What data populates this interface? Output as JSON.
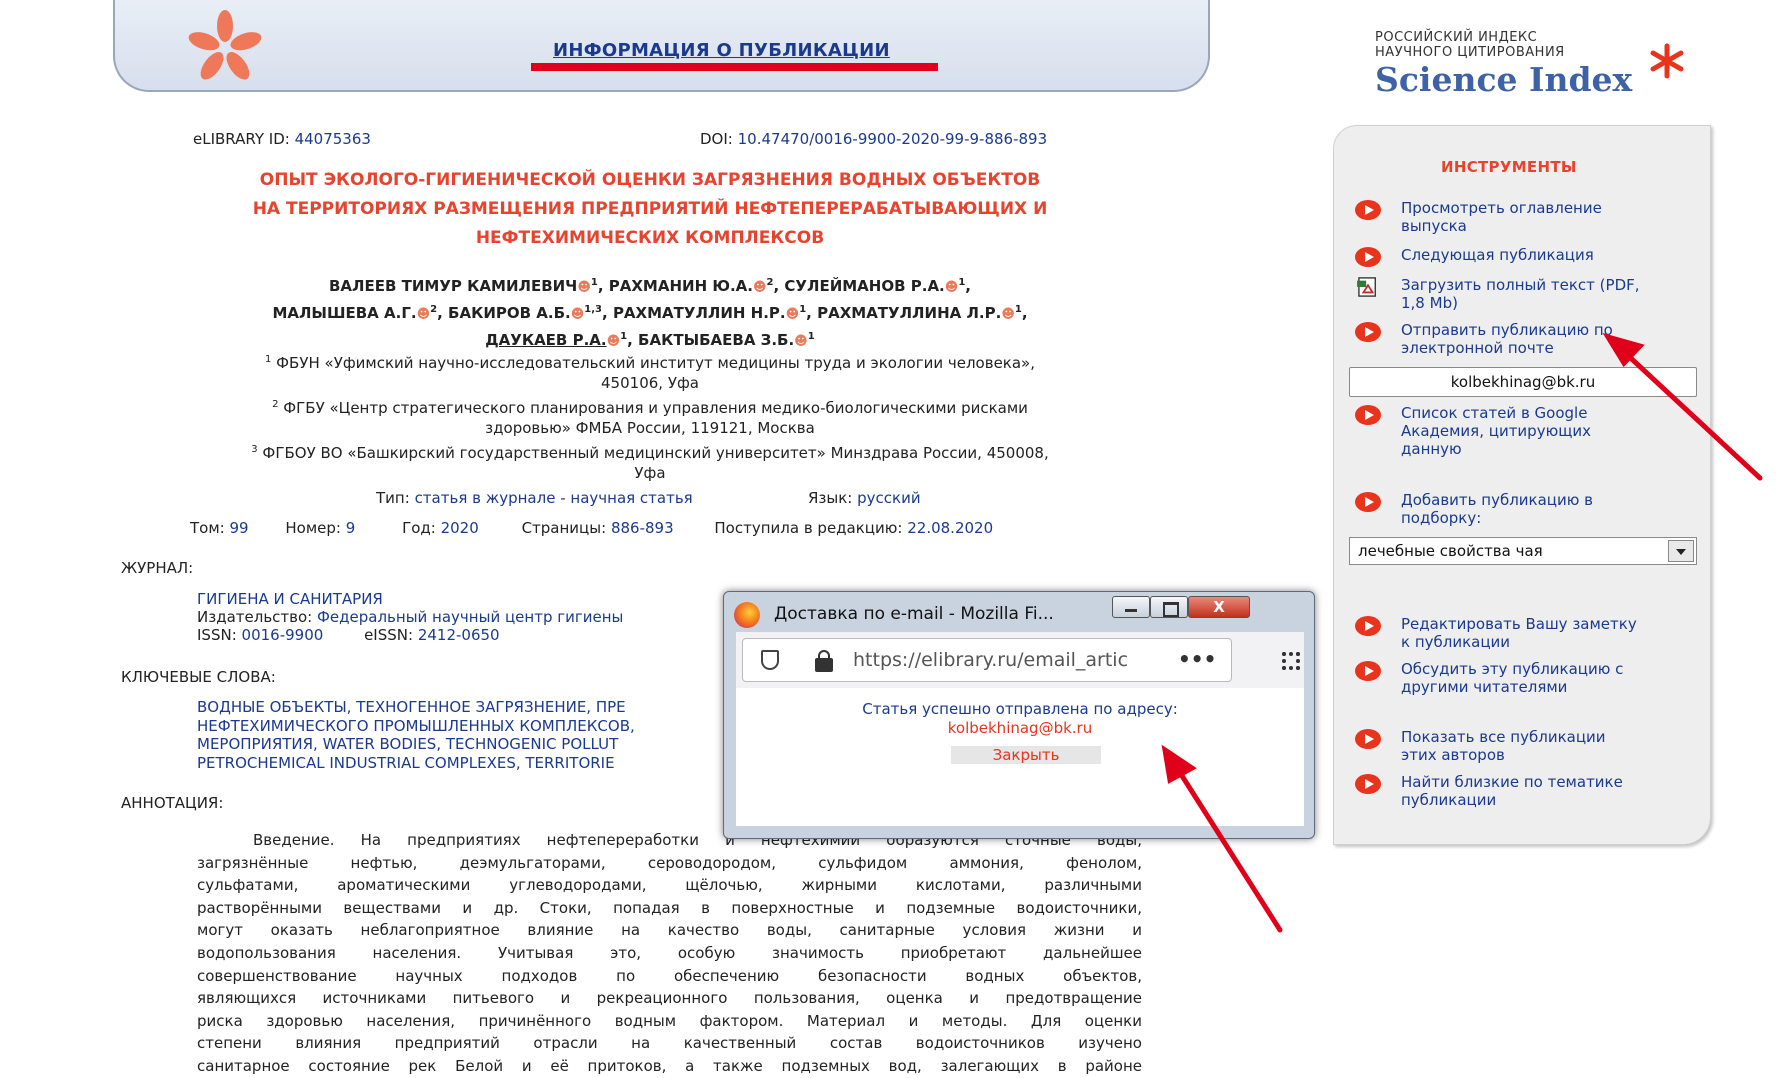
{
  "header": {
    "title": "ИНФОРМАЦИЯ О ПУБЛИКАЦИИ"
  },
  "logo": {
    "line1": "РОССИЙСКИЙ ИНДЕКС",
    "line2": "НАУЧНОГО ЦИТИРОВАНИЯ",
    "brand": "Science Index"
  },
  "publication": {
    "elibrary_label": "eLIBRARY ID:",
    "elibrary_id": "44075363",
    "doi_label": "DOI:",
    "doi": "10.47470/0016-9900-2020-99-9-886-893",
    "title_lines": [
      "ОПЫТ ЭКОЛОГО-ГИГИЕНИЧЕСКОЙ ОЦЕНКИ ЗАГРЯЗНЕНИЯ ВОДНЫХ ОБЪЕКТОВ",
      "НА ТЕРРИТОРИЯХ РАЗМЕЩЕНИЯ ПРЕДПРИЯТИЙ НЕФТЕПЕРЕРАБАТЫВАЮЩИХ И",
      "НЕФТЕХИМИЧЕСКИХ КОМПЛЕКСОВ"
    ],
    "authors": [
      {
        "name": "ВАЛЕЕВ ТИМУР КАМИЛЕВИЧ",
        "aff": "1"
      },
      {
        "name": "РАХМАНИН Ю.А.",
        "aff": "2"
      },
      {
        "name": "СУЛЕЙМАНОВ Р.А.",
        "aff": "1"
      },
      {
        "name": "МАЛЫШЕВА А.Г.",
        "aff": "2"
      },
      {
        "name": "БАКИРОВ А.Б.",
        "aff": "1,3"
      },
      {
        "name": "РАХМАТУЛЛИН Н.Р.",
        "aff": "1"
      },
      {
        "name": "РАХМАТУЛЛИНА Л.Р.",
        "aff": "1"
      },
      {
        "name": "ДАУКАЕВ Р.А.",
        "aff": "1"
      },
      {
        "name": "БАКТЫБАЕВА З.Б.",
        "aff": "1"
      }
    ],
    "affiliations": [
      {
        "num": "1",
        "line1": "ФБУН «Уфимский научно-исследовательский институт медицины труда и экологии человека»,",
        "line2": "450106, Уфа"
      },
      {
        "num": "2",
        "line1": "ФГБУ «Центр стратегического планирования и управления медико-биологическими рисками",
        "line2": "здоровью» ФМБА России, 119121, Москва"
      },
      {
        "num": "3",
        "line1": "ФГБОУ ВО «Башкирский государственный медицинский университет» Минздрава России, 450008,",
        "line2": "Уфа"
      }
    ],
    "type_label": "Тип:",
    "type_value": "статья в журнале - научная статья",
    "lang_label": "Язык:",
    "lang_value": "русский",
    "volume_label": "Том:",
    "volume": "99",
    "issue_label": "Номер:",
    "issue": "9",
    "year_label": "Год:",
    "year": "2020",
    "pages_label": "Страницы:",
    "pages": "886-893",
    "received_label": "Поступила в редакцию:",
    "received": "22.08.2020"
  },
  "journal": {
    "heading": "ЖУРНАЛ:",
    "name": "ГИГИЕНА И САНИТАРИЯ",
    "publisher_label": "Издательство:",
    "publisher": "Федеральный научный центр гигиены",
    "issn_label": "ISSN:",
    "issn": "0016-9900",
    "eissn_label": "eISSN:",
    "eissn": "2412-0650"
  },
  "keywords": {
    "heading": "КЛЮЧЕВЫЕ СЛОВА:",
    "lines": [
      "ВОДНЫЕ ОБЪЕКТЫ, ТЕХНОГЕННОЕ ЗАГРЯЗНЕНИЕ, ПРЕ",
      "НЕФТЕХИМИЧЕСКОГО ПРОМЫШЛЕННЫХ КОМПЛЕКСОВ,",
      "МЕРОПРИЯТИЯ, WATER BODIES, TECHNOGENIC POLLUT",
      "PETROCHEMICAL INDUSTRIAL COMPLEXES, TERRITORIE"
    ]
  },
  "annotation": {
    "heading": "АННОТАЦИЯ:",
    "lines": [
      "Введение. На предприятиях нефтепереработки и нефтехимии образуются сточные воды,",
      "загрязнённые нефтью, деэмульгаторами, сероводородом, сульфидом аммония, фенолом,",
      "сульфатами, ароматическими углеводородами, щёлочью, жирными кислотами, различными",
      "растворёнными веществами и др. Стоки, попадая в поверхностные и подземные водоисточники,",
      "могут оказать неблагоприятное влияние на качество воды, санитарные условия жизни и",
      "водопользования населения. Учитывая это, особую значимость приобретают дальнейшее",
      "совершенствование научных подходов по обеспечению безопасности водных объектов,",
      "являющихся источниками питьевого и рекреационного пользования, оценка и предотвращение",
      "риска здоровью населения, причинённого водным фактором. Материал и методы. Для оценки",
      "степени влияния предприятий отрасли на качественный состав водоисточников изучено",
      "санитарное состояние рек Белой и её притоков, а также подземных вод, залегающих в районе"
    ]
  },
  "sidebar": {
    "title": "ИНСТРУМЕНТЫ",
    "items": [
      {
        "line1": "Просмотреть оглавление",
        "line2": "выпуска",
        "icon": "play-icon"
      },
      {
        "line1": "Следующая публикация",
        "line2": "",
        "icon": "play-icon"
      },
      {
        "line1": "Загрузить полный текст (PDF,",
        "line2": "1,8 Mb)",
        "icon": "pdf-icon"
      },
      {
        "line1": "Отправить публикацию по",
        "line2": "электронной почте",
        "icon": "play-icon"
      },
      {
        "line1": "Список статей в Google",
        "line2": "Академия, цитирующих",
        "line3": "данную",
        "icon": "play-icon"
      },
      {
        "line1": "Добавить публикацию в",
        "line2": "подборку:",
        "icon": "play-icon"
      },
      {
        "line1": "Редактировать Вашу заметку",
        "line2": "к публикации",
        "icon": "play-icon"
      },
      {
        "line1": "Обсудить эту публикацию с",
        "line2": "другими читателями",
        "icon": "play-icon"
      },
      {
        "line1": "Показать все публикации",
        "line2": "этих авторов",
        "icon": "play-icon"
      },
      {
        "line1": "Найти близкие по тематике",
        "line2": "публикации",
        "icon": "play-icon"
      }
    ],
    "email_value": "kolbekhinag@bk.ru",
    "collection_selected": "лечебные свойства чая"
  },
  "popup": {
    "window_title": "Доставка по e-mail - Mozilla Fi...",
    "url": "https://elibrary.ru/email_artic",
    "url_more": "•••",
    "message": "Статья успешно отправлена по адресу:",
    "email": "kolbekhinag@bk.ru",
    "close_label": "Закрыть",
    "close_x": "X"
  },
  "colors": {
    "link": "#1a3a8f",
    "title_red": "#e8432e",
    "annotation_red": "#e0001a",
    "sidebar_bg": "#eeeeee"
  }
}
